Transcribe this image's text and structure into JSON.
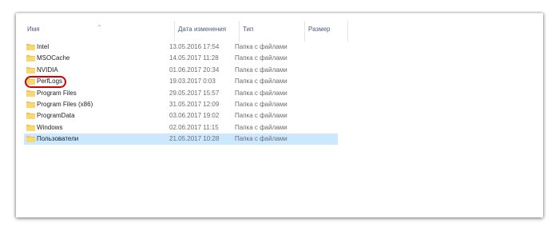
{
  "columns": {
    "name": "Имя",
    "date": "Дата изменения",
    "type": "Тип",
    "size": "Размер"
  },
  "folder_icon_color": "#f0c64a",
  "highlight_color": "#d40000",
  "selection_color": "#cce8ff",
  "files": [
    {
      "name": "Intel",
      "date": "13.05.2016 17:54",
      "type": "Папка с файлами"
    },
    {
      "name": "MSOCache",
      "date": "14.05.2017 11:28",
      "type": "Папка с файлами"
    },
    {
      "name": "NVIDIA",
      "date": "01.06.2017 20:34",
      "type": "Папка с файлами",
      "highlighted": true
    },
    {
      "name": "PerfLogs",
      "date": "19.03.2017 0:03",
      "type": "Папка с файлами"
    },
    {
      "name": "Program Files",
      "date": "29.05.2017 15:57",
      "type": "Папка с файлами"
    },
    {
      "name": "Program Files (x86)",
      "date": "31.05.2017 12:09",
      "type": "Папка с файлами"
    },
    {
      "name": "ProgramData",
      "date": "03.06.2017 19:02",
      "type": "Папка с файлами"
    },
    {
      "name": "Windows",
      "date": "02.06.2017 11:15",
      "type": "Папка с файлами"
    },
    {
      "name": "Пользователи",
      "date": "21.05.2017 10:28",
      "type": "Папка с файлами",
      "selected": true
    }
  ]
}
